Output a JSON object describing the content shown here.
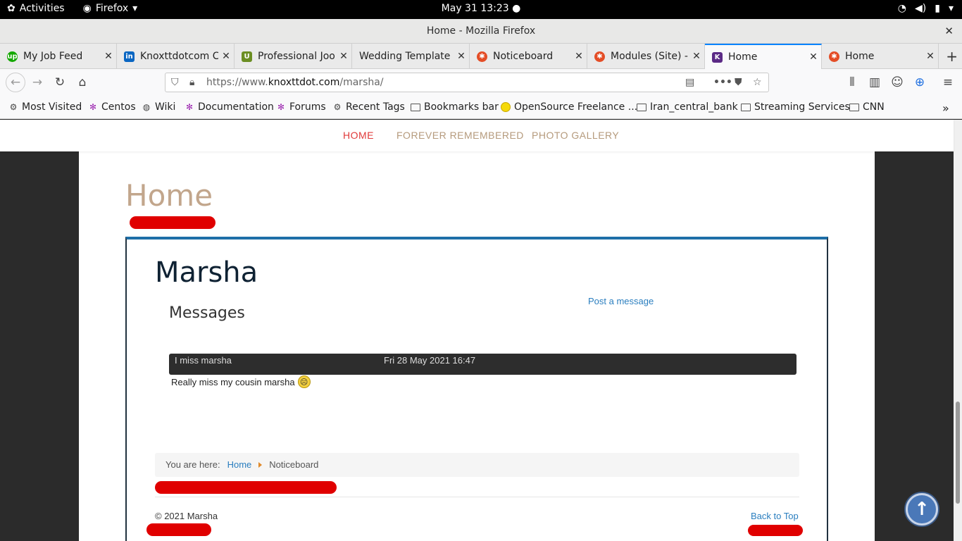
{
  "system": {
    "activities": "Activities",
    "app_menu": "Firefox",
    "clock": "May 31  13:23"
  },
  "window": {
    "title": "Home - Mozilla Firefox"
  },
  "tabs": [
    {
      "label": "My Job Feed",
      "icon": "upwork-icon",
      "color": "#14a800"
    },
    {
      "label": "Knoxttdotcom C",
      "icon": "linkedin-icon",
      "color": "#0a66c2"
    },
    {
      "label": "Professional Joo",
      "icon": "template-icon",
      "color": "#6b8e23"
    },
    {
      "label": "Wedding Template",
      "icon": "",
      "color": ""
    },
    {
      "label": "Noticeboard",
      "icon": "joomla-icon",
      "color": "#e44d26"
    },
    {
      "label": "Modules (Site) -",
      "icon": "joomla-icon",
      "color": "#e44d26"
    },
    {
      "label": "Home",
      "icon": "k-icon",
      "color": "#5b2a86"
    },
    {
      "label": "Home",
      "icon": "joomla-icon",
      "color": "#e44d26"
    }
  ],
  "url": {
    "prefix": "https://www.",
    "domain": "knoxttdot.com",
    "path": "/marsha/"
  },
  "bookmarks": [
    {
      "label": "Most Visited",
      "icon": "gear-icon"
    },
    {
      "label": "Centos",
      "icon": "centos-icon"
    },
    {
      "label": "Wiki",
      "icon": "globe-icon"
    },
    {
      "label": "Documentation",
      "icon": "centos-icon"
    },
    {
      "label": "Forums",
      "icon": "centos-icon"
    },
    {
      "label": "Recent Tags",
      "icon": "gear-icon"
    },
    {
      "label": "Bookmarks bar",
      "icon": "folder-icon"
    },
    {
      "label": "OpenSource Freelance ...",
      "icon": "circle-icon"
    },
    {
      "label": "Iran_central_bank",
      "icon": "folder-icon"
    },
    {
      "label": "Streaming Services",
      "icon": "folder-icon"
    },
    {
      "label": "CNN",
      "icon": "folder-icon"
    }
  ],
  "site_nav": [
    "HOME",
    "FOREVER REMEMBERED",
    "PHOTO GALLERY"
  ],
  "page": {
    "heading": "Home",
    "card_title": "Marsha",
    "section_title": "Messages",
    "post_link": "Post a message",
    "message": {
      "subject": "I miss marsha",
      "date": "Fri 28 May 2021 16:47",
      "body": "Really miss my cousin marsha"
    },
    "breadcrumb": {
      "prefix": "You are here:",
      "home": "Home",
      "current": "Noticeboard"
    },
    "copyright": "© 2021 Marsha",
    "back_to_top": "Back to Top"
  }
}
